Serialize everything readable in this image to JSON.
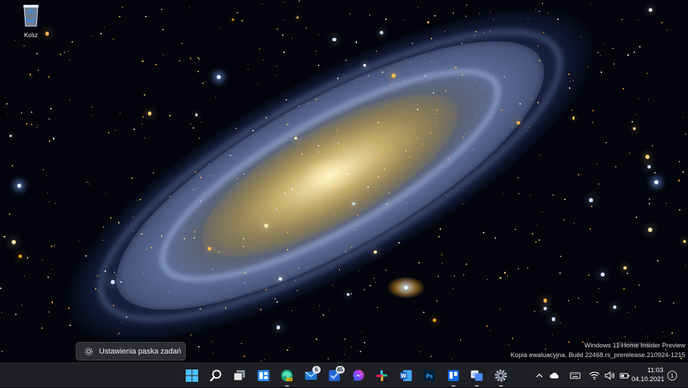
{
  "desktop": {
    "icons": [
      {
        "label": "Kosz",
        "icon": "recycle-bin-icon"
      }
    ],
    "watermark": {
      "line1": "Windows 11 Home Insider Preview",
      "line2": "Kopia ewaluacyjna. Build 22468.rs_prerelease.210924-1215"
    }
  },
  "tooltip": {
    "label": "Ustawienia paska zadań",
    "icon": "gear-icon"
  },
  "taskbar": {
    "apps": [
      {
        "name": "start",
        "icon": "windows-start-icon",
        "badge": ""
      },
      {
        "name": "search",
        "icon": "search-icon",
        "badge": ""
      },
      {
        "name": "task-view",
        "icon": "task-view-icon",
        "badge": ""
      },
      {
        "name": "widgets",
        "icon": "widgets-icon",
        "badge": ""
      },
      {
        "name": "edge-canary",
        "icon": "edge-canary-icon",
        "badge": ""
      },
      {
        "name": "mail",
        "icon": "mail-icon",
        "badge": "6"
      },
      {
        "name": "todo",
        "icon": "todo-icon",
        "badge": "45"
      },
      {
        "name": "messenger",
        "icon": "messenger-icon",
        "badge": ""
      },
      {
        "name": "slack",
        "icon": "slack-icon",
        "badge": ""
      },
      {
        "name": "word",
        "icon": "word-icon",
        "badge": ""
      },
      {
        "name": "photoshop",
        "icon": "photoshop-icon",
        "badge": ""
      },
      {
        "name": "trello",
        "icon": "trello-icon",
        "badge": ""
      },
      {
        "name": "translator",
        "icon": "translator-icon",
        "badge": ""
      },
      {
        "name": "settings",
        "icon": "settings-gear-icon",
        "badge": ""
      }
    ],
    "tray": {
      "icons": [
        "chevron-up-icon",
        "onedrive-cloud-icon",
        "keyboard-icon",
        "wifi-icon",
        "volume-icon",
        "battery-icon"
      ],
      "time": "11:03",
      "date": "04.10.2021",
      "notification_count": "1"
    }
  },
  "colors": {
    "taskbar_bg": "#1f2024",
    "tooltip_bg": "#2b2d33",
    "accent_blue": "#2f8fff"
  }
}
